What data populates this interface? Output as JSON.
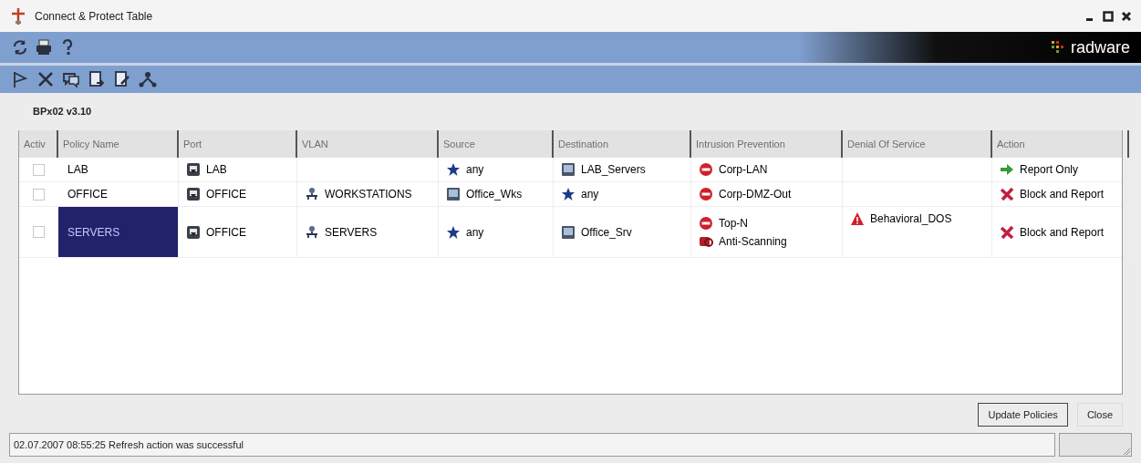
{
  "window": {
    "title": "Connect & Protect Table"
  },
  "brand": "radware",
  "device_label": "BPx02 v3.10",
  "table": {
    "columns": [
      "Activ",
      "Policy Name",
      "Port",
      "VLAN",
      "Source",
      "Destination",
      "Intrusion Prevention",
      "Denial Of Service",
      "Action"
    ],
    "rows": [
      {
        "checked": false,
        "selected": false,
        "policy_name": "LAB",
        "port": {
          "kind": "port",
          "text": "LAB"
        },
        "source": {
          "kind": "star",
          "text": "any"
        },
        "destination": {
          "kind": "host",
          "text": "LAB_Servers"
        },
        "intrusion_prevention": [
          {
            "kind": "stop",
            "text": "Corp-LAN"
          }
        ],
        "action": {
          "kind": "arrow",
          "text": "Report Only"
        }
      },
      {
        "checked": false,
        "selected": false,
        "policy_name": "OFFICE",
        "port": {
          "kind": "port",
          "text": "OFFICE"
        },
        "vlan": {
          "kind": "vlan",
          "text": "WORKSTATIONS"
        },
        "source": {
          "kind": "host",
          "text": "Office_Wks"
        },
        "destination": {
          "kind": "star",
          "text": "any"
        },
        "intrusion_prevention": [
          {
            "kind": "stop",
            "text": "Corp-DMZ-Out"
          }
        ],
        "action": {
          "kind": "cross",
          "text": "Block and Report"
        }
      },
      {
        "checked": false,
        "selected": true,
        "policy_name": "SERVERS",
        "port": {
          "kind": "port",
          "text": "OFFICE"
        },
        "vlan": {
          "kind": "vlan",
          "text": "SERVERS"
        },
        "source": {
          "kind": "star",
          "text": "any"
        },
        "destination": {
          "kind": "host",
          "text": "Office_Srv"
        },
        "intrusion_prevention": [
          {
            "kind": "stop",
            "text": "Top-N"
          },
          {
            "kind": "scan",
            "text": "Anti-Scanning"
          }
        ],
        "denial_of_service": {
          "kind": "warning",
          "text": "Behavioral_DOS"
        },
        "action": {
          "kind": "cross",
          "text": "Block and Report"
        }
      }
    ]
  },
  "buttons": [
    {
      "label": "Update Policies",
      "focused": true
    },
    {
      "label": "Close",
      "focused": false
    }
  ],
  "status_bar": {
    "message": "02.07.2007 08:55:25 Refresh action was successful"
  }
}
